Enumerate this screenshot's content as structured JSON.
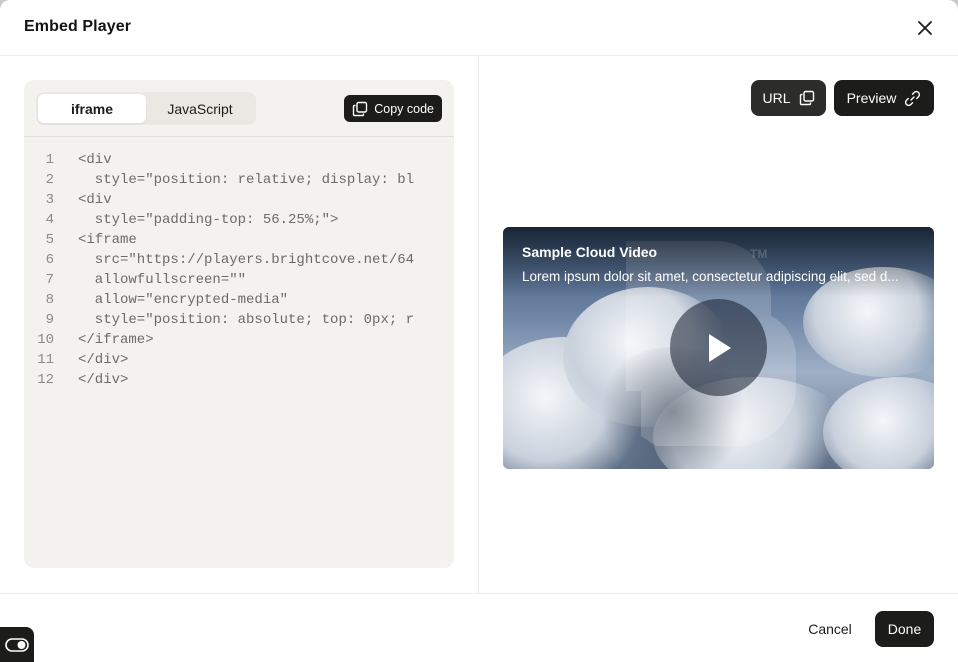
{
  "dialog": {
    "title": "Embed Player",
    "close_icon": "close-icon"
  },
  "code_panel": {
    "tabs": [
      {
        "label": "iframe",
        "active": true
      },
      {
        "label": "JavaScript",
        "active": false
      }
    ],
    "copy_button": {
      "label": "Copy code",
      "icon": "copy-icon"
    },
    "lines": [
      {
        "num": "1",
        "text": "<div"
      },
      {
        "num": "2",
        "text": "  style=\"position: relative; display: bl"
      },
      {
        "num": "3",
        "text": "<div"
      },
      {
        "num": "4",
        "text": "  style=\"padding-top: 56.25%;\">"
      },
      {
        "num": "5",
        "text": "<iframe"
      },
      {
        "num": "6",
        "text": "  src=\"https://players.brightcove.net/64"
      },
      {
        "num": "7",
        "text": "  allowfullscreen=\"\""
      },
      {
        "num": "8",
        "text": "  allow=\"encrypted-media\""
      },
      {
        "num": "9",
        "text": "  style=\"position: absolute; top: 0px; r"
      },
      {
        "num": "10",
        "text": "</iframe>"
      },
      {
        "num": "11",
        "text": "</div>"
      },
      {
        "num": "12",
        "text": "</div>"
      }
    ]
  },
  "preview_panel": {
    "url_button": {
      "label": "URL",
      "icon": "copy-icon"
    },
    "preview_button": {
      "label": "Preview",
      "icon": "link-icon"
    },
    "player": {
      "video_title": "Sample Cloud Video",
      "video_description": "Lorem ipsum dolor sit amet, consectetur adipiscing elit, sed d...",
      "trademark": "TM",
      "play_icon": "play-icon"
    }
  },
  "footer": {
    "cancel_label": "Cancel",
    "done_label": "Done",
    "toggle_icon": "toggle-icon"
  },
  "colors": {
    "primary_button": "#1c1c1a",
    "code_background": "#f3f2ee"
  }
}
